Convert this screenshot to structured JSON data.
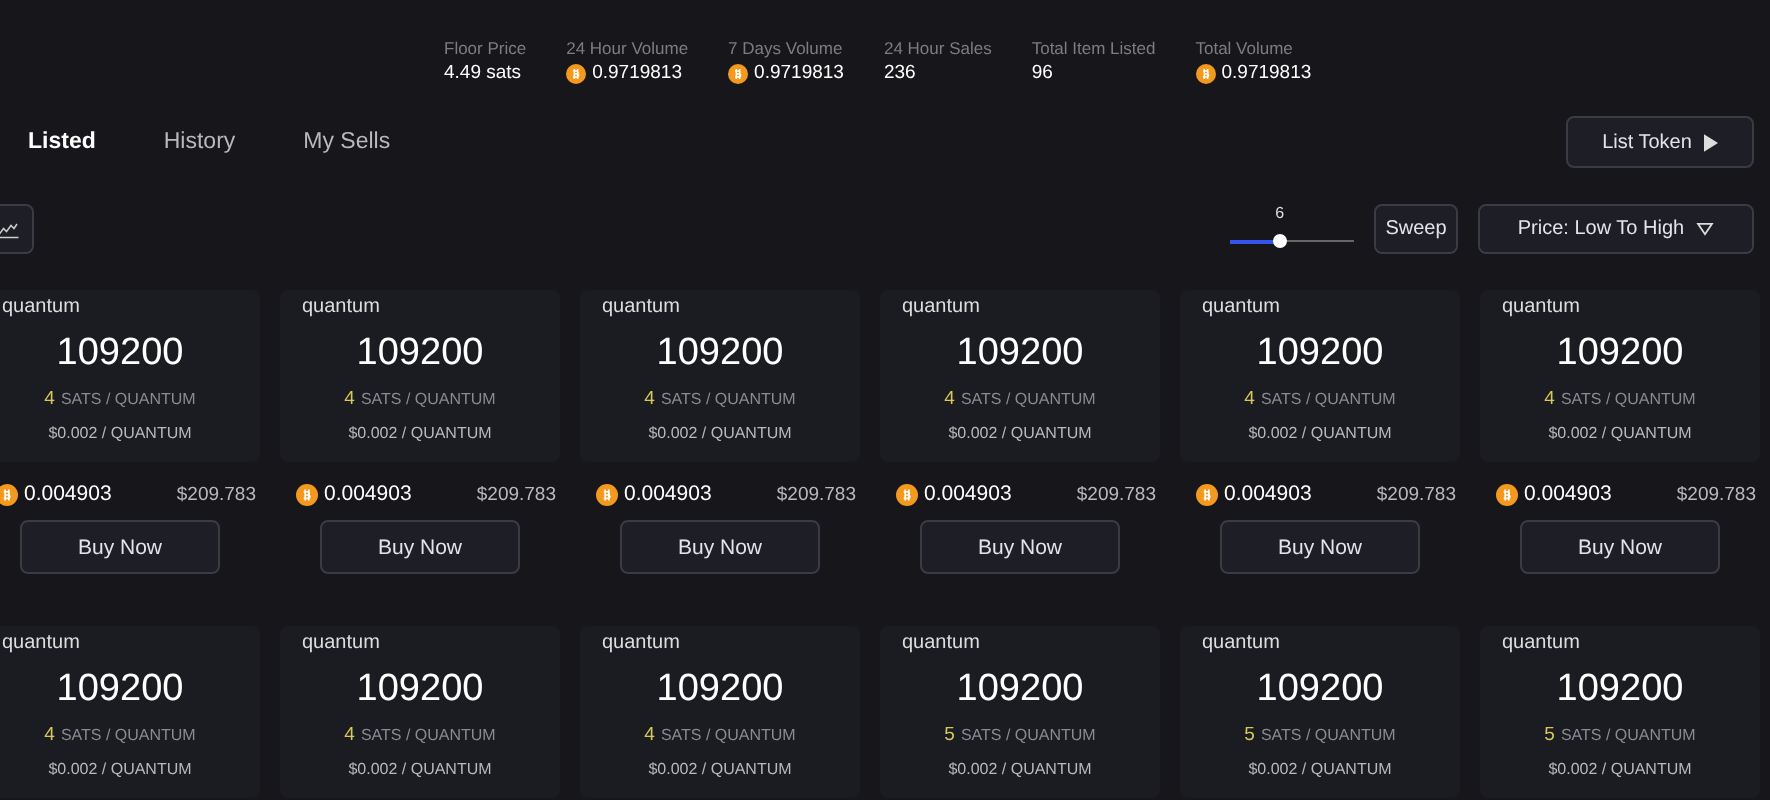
{
  "stats": [
    {
      "label": "Floor Price",
      "value": "4.49 sats",
      "coin": false
    },
    {
      "label": "24 Hour Volume",
      "value": "0.9719813",
      "coin": true
    },
    {
      "label": "7 Days Volume",
      "value": "0.9719813",
      "coin": true
    },
    {
      "label": "24 Hour Sales",
      "value": "236",
      "coin": false
    },
    {
      "label": "Total Item Listed",
      "value": "96",
      "coin": false
    },
    {
      "label": "Total Volume",
      "value": "0.9719813",
      "coin": true
    }
  ],
  "tabs": [
    {
      "label": "Listed",
      "selected": true
    },
    {
      "label": "History",
      "selected": false
    },
    {
      "label": "My Sells",
      "selected": false
    }
  ],
  "list_button": {
    "label": "List Token"
  },
  "slider": {
    "value": "6",
    "level": 0.4
  },
  "sweep_button": {
    "label": "Sweep"
  },
  "sort": {
    "label": "Price: Low To High"
  },
  "rows": [
    [
      {
        "ticker": "quantum",
        "amount": "109200",
        "sats": "4",
        "sats_unit": "SATS / QUANTUM",
        "usd_price": "$0.002 / QUANTUM",
        "btc_price": "0.004903",
        "usd_total": "$209.783",
        "button": "Buy Now"
      },
      {
        "ticker": "quantum",
        "amount": "109200",
        "sats": "4",
        "sats_unit": "SATS / QUANTUM",
        "usd_price": "$0.002 / QUANTUM",
        "btc_price": "0.004903",
        "usd_total": "$209.783",
        "button": "Buy Now"
      },
      {
        "ticker": "quantum",
        "amount": "109200",
        "sats": "4",
        "sats_unit": "SATS / QUANTUM",
        "usd_price": "$0.002 / QUANTUM",
        "btc_price": "0.004903",
        "usd_total": "$209.783",
        "button": "Buy Now"
      },
      {
        "ticker": "quantum",
        "amount": "109200",
        "sats": "4",
        "sats_unit": "SATS / QUANTUM",
        "usd_price": "$0.002 / QUANTUM",
        "btc_price": "0.004903",
        "usd_total": "$209.783",
        "button": "Buy Now"
      },
      {
        "ticker": "quantum",
        "amount": "109200",
        "sats": "4",
        "sats_unit": "SATS / QUANTUM",
        "usd_price": "$0.002 / QUANTUM",
        "btc_price": "0.004903",
        "usd_total": "$209.783",
        "button": "Buy Now"
      },
      {
        "ticker": "quantum",
        "amount": "109200",
        "sats": "4",
        "sats_unit": "SATS / QUANTUM",
        "usd_price": "$0.002 / QUANTUM",
        "btc_price": "0.004903",
        "usd_total": "$209.783",
        "button": "Buy Now"
      }
    ],
    [
      {
        "ticker": "quantum",
        "amount": "109200",
        "sats": "4",
        "sats_unit": "SATS / QUANTUM",
        "usd_price": "$0.002 / QUANTUM"
      },
      {
        "ticker": "quantum",
        "amount": "109200",
        "sats": "4",
        "sats_unit": "SATS / QUANTUM",
        "usd_price": "$0.002 / QUANTUM"
      },
      {
        "ticker": "quantum",
        "amount": "109200",
        "sats": "4",
        "sats_unit": "SATS / QUANTUM",
        "usd_price": "$0.002 / QUANTUM"
      },
      {
        "ticker": "quantum",
        "amount": "109200",
        "sats": "5",
        "sats_unit": "SATS / QUANTUM",
        "usd_price": "$0.002 / QUANTUM"
      },
      {
        "ticker": "quantum",
        "amount": "109200",
        "sats": "5",
        "sats_unit": "SATS / QUANTUM",
        "usd_price": "$0.002 / QUANTUM"
      },
      {
        "ticker": "quantum",
        "amount": "109200",
        "sats": "5",
        "sats_unit": "SATS / QUANTUM",
        "usd_price": "$0.002 / QUANTUM"
      }
    ]
  ]
}
